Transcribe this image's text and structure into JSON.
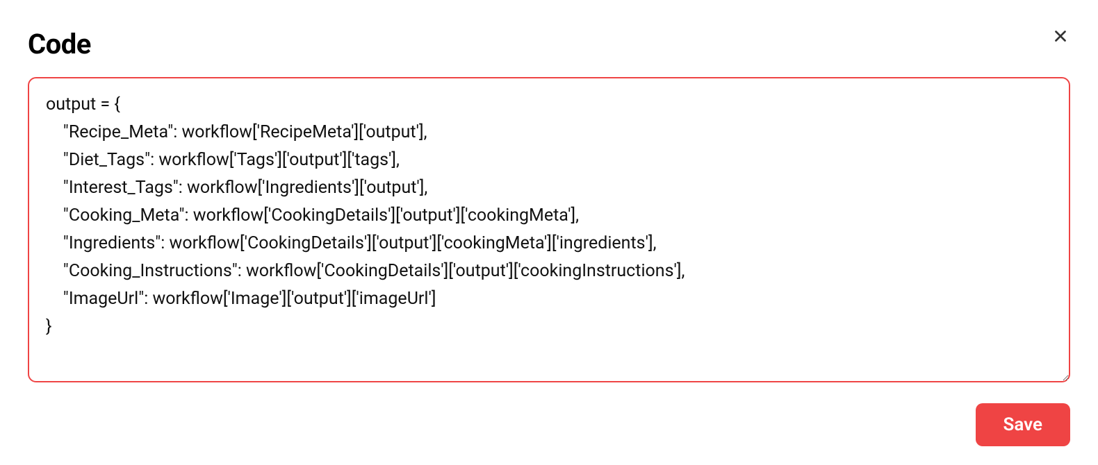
{
  "modal": {
    "title": "Code",
    "save_label": "Save",
    "code_content": "output = {\n    \"Recipe_Meta\": workflow['RecipeMeta']['output'],\n    \"Diet_Tags\": workflow['Tags']['output']['tags'],\n    \"Interest_Tags\": workflow['Ingredients']['output'],\n    \"Cooking_Meta\": workflow['CookingDetails']['output']['cookingMeta'],\n    \"Ingredients\": workflow['CookingDetails']['output']['cookingMeta']['ingredients'],\n    \"Cooking_Instructions\": workflow['CookingDetails']['output']['cookingInstructions'],\n    \"ImageUrl\": workflow['Image']['output']['imageUrl']\n}"
  }
}
